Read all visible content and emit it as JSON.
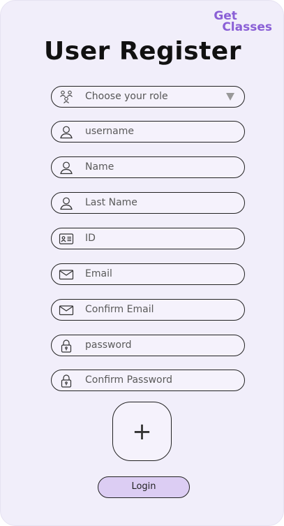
{
  "brand": {
    "line1": "Get",
    "line2": "Classes",
    "color": "#8a5fd6"
  },
  "title": "User Register",
  "form": {
    "role": {
      "placeholder": "Choose your role",
      "icon": "users-group-icon"
    },
    "username": {
      "placeholder": "username",
      "icon": "user-icon"
    },
    "name": {
      "placeholder": "Name",
      "icon": "user-icon"
    },
    "last_name": {
      "placeholder": "Last Name",
      "icon": "user-icon"
    },
    "id": {
      "placeholder": "ID",
      "icon": "id-card-icon"
    },
    "email": {
      "placeholder": "Email",
      "icon": "envelope-icon"
    },
    "confirm_email": {
      "placeholder": "Confirm Email",
      "icon": "envelope-icon"
    },
    "password": {
      "placeholder": "password",
      "icon": "lock-icon"
    },
    "confirm_password": {
      "placeholder": "Confirm Password",
      "icon": "lock-icon"
    }
  },
  "add_button": {
    "label": "+",
    "icon": "plus-icon"
  },
  "login_button": {
    "label": "Login",
    "color": "#dccdf3"
  },
  "background": "#f1eefa"
}
